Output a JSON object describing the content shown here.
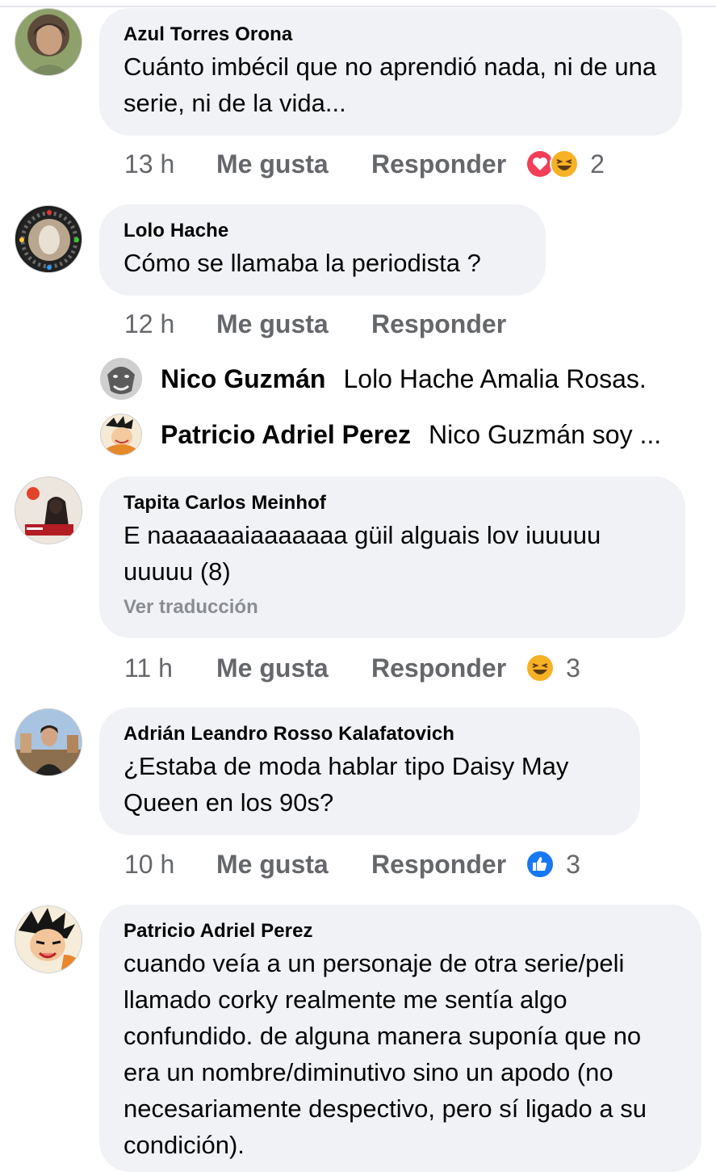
{
  "comments": [
    {
      "author": "Azul Torres Orona",
      "text": "Cuánto imbécil que no aprendió nada, ni de una serie, ni de la vida...",
      "time": "13 h",
      "like_label": "Me gusta",
      "reply_label": "Responder",
      "reactions": [
        "love-reaction-icon",
        "haha-reaction-icon"
      ],
      "reaction_count": "2"
    },
    {
      "author": "Lolo Hache",
      "text": "Cómo se llamaba la periodista ?",
      "time": "12 h",
      "like_label": "Me gusta",
      "reply_label": "Responder",
      "replies": [
        {
          "author": "Nico Guzmán",
          "text": "Lolo Hache Amalia Rosas."
        },
        {
          "author": "Patricio Adriel Perez",
          "text": "Nico Guzmán soy ..."
        }
      ]
    },
    {
      "author": "Tapita Carlos Meinhof",
      "text": "E naaaaaaiaaaaaaa güil alguais lov iuuuuu uuuuu (8)",
      "see_translation": "Ver traducción",
      "time": "11 h",
      "like_label": "Me gusta",
      "reply_label": "Responder",
      "reactions": [
        "haha-reaction-icon"
      ],
      "reaction_count": "3"
    },
    {
      "author": "Adrián Leandro Rosso Kalafatovich",
      "text": "¿Estaba de moda hablar tipo Daisy May Queen en los 90s?",
      "time": "10 h",
      "like_label": "Me gusta",
      "reply_label": "Responder",
      "reactions": [
        "like-reaction-icon"
      ],
      "reaction_count": "3"
    },
    {
      "author": "Patricio Adriel Perez",
      "text": "cuando veía a un personaje de otra serie/peli llamado corky realmente me sentía algo confundido. de alguna manera suponía que no era un nombre/diminutivo sino un apodo (no necesariamente despectivo, pero sí ligado a su condición)."
    }
  ],
  "colors": {
    "bubble": "#f0f2f5",
    "meta_text": "#65676b",
    "like_blue": "#1877f2",
    "love_red": "#f33e58",
    "haha_yellow": "#f7b125"
  }
}
